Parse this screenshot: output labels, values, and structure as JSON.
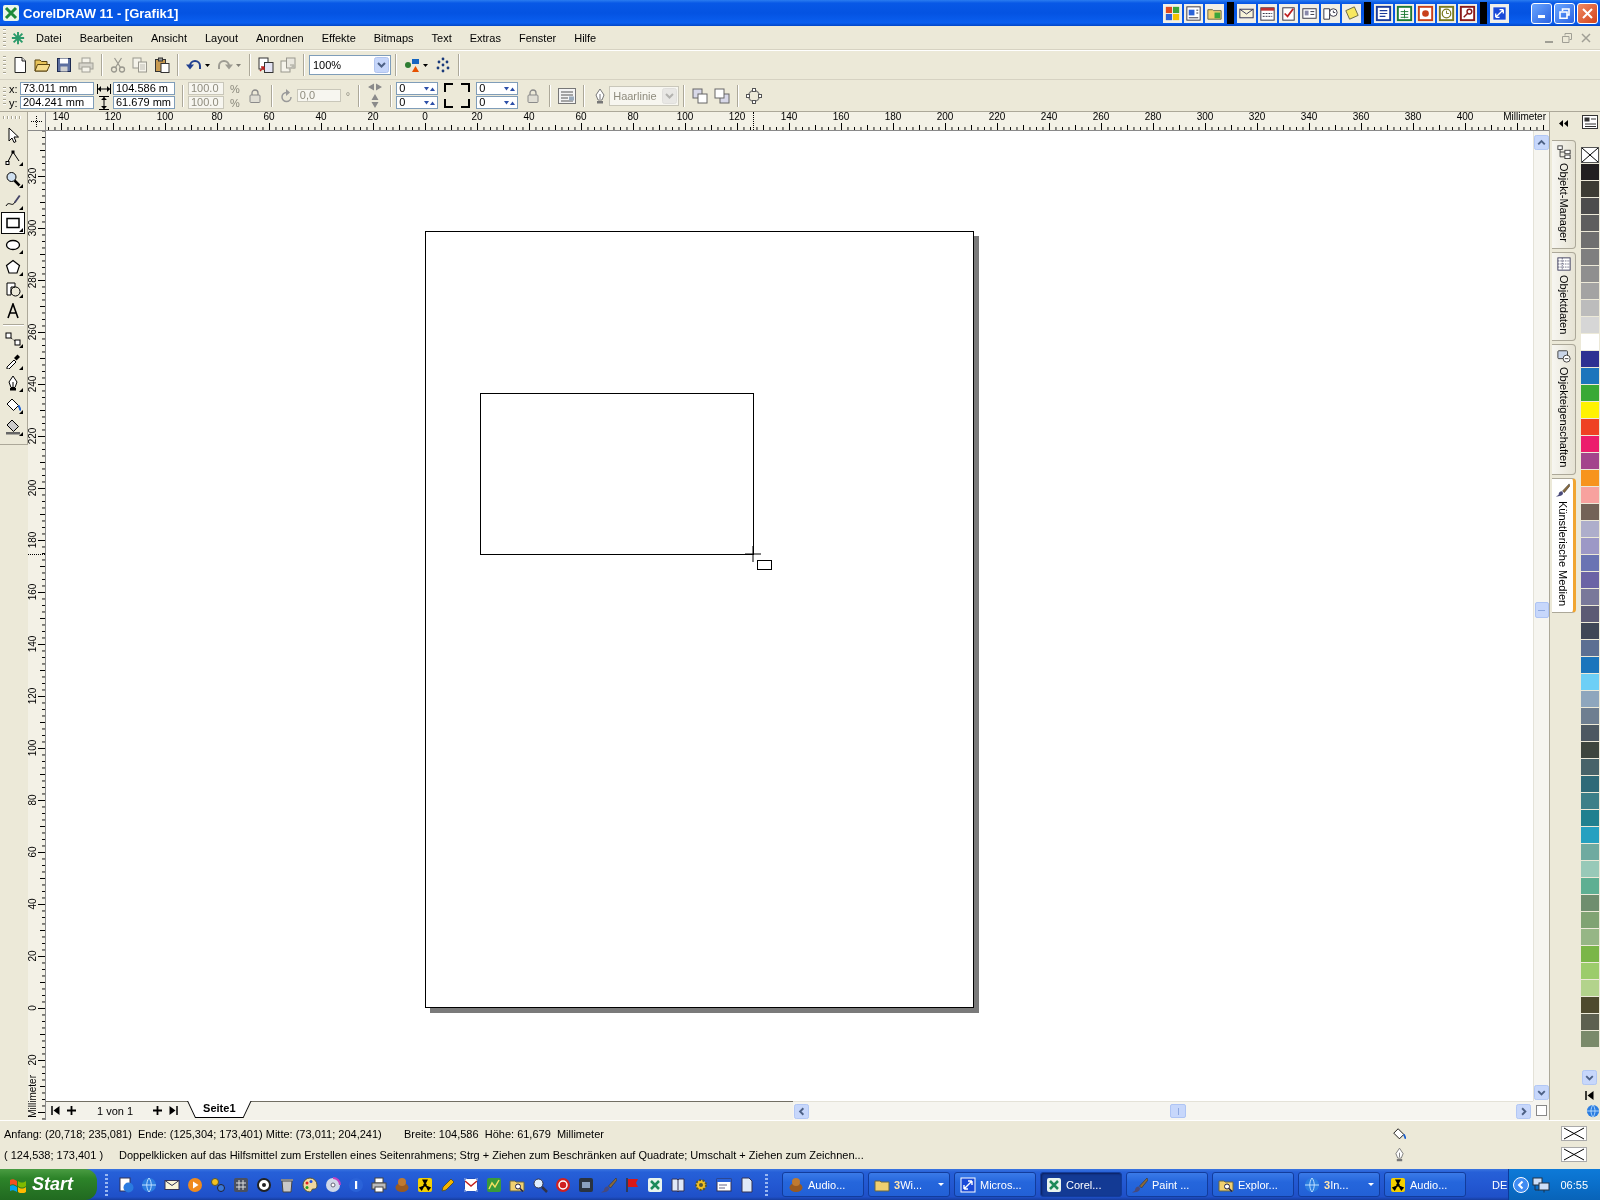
{
  "window": {
    "title": "CorelDRAW 11 - [Grafik1]"
  },
  "menu": [
    "Datei",
    "Bearbeiten",
    "Ansicht",
    "Layout",
    "Anordnen",
    "Effekte",
    "Bitmaps",
    "Text",
    "Extras",
    "Fenster",
    "Hilfe"
  ],
  "document_buttons": {
    "disabled": true
  },
  "standard_toolbar": {
    "left_buttons": [
      {
        "kind": "button",
        "disabled": false
      },
      {
        "kind": "button",
        "disabled": false
      },
      {
        "kind": "button",
        "disabled": false
      },
      {
        "kind": "button",
        "disabled": true
      },
      {
        "kind": "button",
        "disabled": true
      },
      {
        "kind": "button",
        "disabled": true
      },
      {
        "kind": "button",
        "disabled": false
      },
      {
        "kind": "split",
        "disabled": false
      },
      {
        "kind": "split",
        "disabled": true
      },
      {
        "kind": "button",
        "disabled": false
      },
      {
        "kind": "button",
        "disabled": true
      }
    ],
    "zoom": {
      "value": "100%"
    },
    "right_buttons": [
      {
        "kind": "split",
        "disabled": false
      },
      {
        "kind": "button",
        "disabled": false
      }
    ]
  },
  "property_bar": {
    "x": {
      "label": "x:",
      "value": "73.011 mm"
    },
    "y": {
      "label": "y:",
      "value": "204.241 mm"
    },
    "width": {
      "value": "104.586 m"
    },
    "height": {
      "value": "61.679 mm"
    },
    "scale": [
      {
        "value": "100.0",
        "unit": "%",
        "disabled": true
      },
      {
        "value": "100.0",
        "unit": "%",
        "disabled": true
      }
    ],
    "rotation": {
      "value": "0,0",
      "unit": "°",
      "disabled": true
    },
    "corner_roundness": [
      "0",
      "0",
      "0",
      "0"
    ],
    "outline_width": {
      "value": "Haarlinie",
      "disabled": true
    }
  },
  "rulers": {
    "horizontal": {
      "labels": [
        "140",
        "120",
        "100",
        "80",
        "60",
        "40",
        "20",
        "0",
        "20",
        "40",
        "60",
        "80",
        "100",
        "120",
        "140",
        "160",
        "180",
        "200",
        "220",
        "240",
        "260",
        "280",
        "300",
        "320",
        "340",
        "360",
        "380",
        "400"
      ],
      "unit": "Millimeter"
    },
    "vertical": {
      "labels": [
        "320",
        "300",
        "280",
        "260",
        "240",
        "220",
        "200",
        "180",
        "160",
        "140",
        "120",
        "100",
        "80",
        "60",
        "40",
        "20",
        "0",
        "20"
      ],
      "unit": "Millimeter"
    }
  },
  "toolbox": {
    "tools": [
      {
        "selected": false,
        "flyout": false
      },
      {
        "selected": false,
        "flyout": true
      },
      {
        "selected": false,
        "flyout": true
      },
      {
        "selected": false,
        "flyout": true
      },
      {
        "selected": true,
        "flyout": true
      },
      {
        "selected": false,
        "flyout": true
      },
      {
        "selected": false,
        "flyout": true
      },
      {
        "selected": false,
        "flyout": true
      },
      {
        "selected": false,
        "flyout": false
      },
      {
        "selected": false,
        "flyout": true
      },
      {
        "selected": false,
        "flyout": true
      },
      {
        "selected": false,
        "flyout": true
      },
      {
        "selected": false,
        "flyout": true
      },
      {
        "selected": false,
        "flyout": true
      }
    ]
  },
  "page_navigator": {
    "position": "1 von 1",
    "tabs": [
      {
        "label": "Seite1",
        "selected": true
      }
    ]
  },
  "docker_tabs": [
    {
      "label": "Objekt-Manager",
      "selected": false
    },
    {
      "label": "Objektdaten",
      "selected": false
    },
    {
      "label": "Objekteigenschaften",
      "selected": false
    },
    {
      "label": "Künstlerische Medien",
      "selected": true
    }
  ],
  "palette": {
    "swatches": [
      {
        "kind": "none"
      },
      {
        "kind": "color",
        "color": "#231f20"
      },
      {
        "kind": "color",
        "color": "#3c3b33"
      },
      {
        "kind": "color",
        "color": "#4d4d4d"
      },
      {
        "kind": "color",
        "color": "#5e5e5e"
      },
      {
        "kind": "color",
        "color": "#6f6f6f"
      },
      {
        "kind": "color",
        "color": "#7f7f7f"
      },
      {
        "kind": "color",
        "color": "#8f8f8f"
      },
      {
        "kind": "color",
        "color": "#a3a3a3"
      },
      {
        "kind": "color",
        "color": "#bcbcbc"
      },
      {
        "kind": "color",
        "color": "#d6d6d6"
      },
      {
        "kind": "color",
        "color": "#ffffff"
      },
      {
        "kind": "color",
        "color": "#2e3192"
      },
      {
        "kind": "color",
        "color": "#1c75bc"
      },
      {
        "kind": "color",
        "color": "#39a935"
      },
      {
        "kind": "color",
        "color": "#fff200"
      },
      {
        "kind": "color",
        "color": "#ef4123"
      },
      {
        "kind": "color",
        "color": "#ec1c6c"
      },
      {
        "kind": "color",
        "color": "#a3448c"
      },
      {
        "kind": "color",
        "color": "#f7941d"
      },
      {
        "kind": "color",
        "color": "#f7a29e"
      },
      {
        "kind": "color",
        "color": "#736357"
      },
      {
        "kind": "color",
        "color": "#aeaecb"
      },
      {
        "kind": "color",
        "color": "#9c98c6"
      },
      {
        "kind": "color",
        "color": "#6a74b3"
      },
      {
        "kind": "color",
        "color": "#6b63a5"
      },
      {
        "kind": "color",
        "color": "#79789a"
      },
      {
        "kind": "color",
        "color": "#5c5a74"
      },
      {
        "kind": "color",
        "color": "#3f4656"
      },
      {
        "kind": "color",
        "color": "#5c6f92"
      },
      {
        "kind": "color",
        "color": "#1b75bc"
      },
      {
        "kind": "color",
        "color": "#6dcff6"
      },
      {
        "kind": "color",
        "color": "#8ea6bd"
      },
      {
        "kind": "color",
        "color": "#6e7e90"
      },
      {
        "kind": "color",
        "color": "#4d5861"
      },
      {
        "kind": "color",
        "color": "#3e463e"
      },
      {
        "kind": "color",
        "color": "#476369"
      },
      {
        "kind": "color",
        "color": "#2e6a78"
      },
      {
        "kind": "color",
        "color": "#3c7f88"
      },
      {
        "kind": "color",
        "color": "#20808f"
      },
      {
        "kind": "color",
        "color": "#25a0c0"
      },
      {
        "kind": "color",
        "color": "#6faaa0"
      },
      {
        "kind": "color",
        "color": "#98c9b8"
      },
      {
        "kind": "color",
        "color": "#5eaf92"
      },
      {
        "kind": "color",
        "color": "#6f8e6e"
      },
      {
        "kind": "color",
        "color": "#80a373"
      },
      {
        "kind": "color",
        "color": "#96b686"
      },
      {
        "kind": "color",
        "color": "#7ab648"
      },
      {
        "kind": "color",
        "color": "#9ccc6b"
      },
      {
        "kind": "color",
        "color": "#b3d38c"
      },
      {
        "kind": "color",
        "color": "#4e4a2e"
      },
      {
        "kind": "color",
        "color": "#5d6050"
      },
      {
        "kind": "color",
        "color": "#7a8a6a"
      }
    ]
  },
  "status_bar": {
    "selection": "Anfang: (20,718; 235,081)  Ende: (125,304; 173,401) Mitte: (73,011; 204,241)",
    "size": "Breite: 104,586  Höhe: 61,679  Millimeter",
    "cursor": "( 124,538; 173,401 )",
    "hint": "Doppelklicken auf das Hilfsmittel zum Erstellen eines Seitenrahmens; Strg + Ziehen zum Beschränken auf Quadrate; Umschalt + Ziehen zum Zeichnen...",
    "fill": {
      "kind": "none"
    },
    "outline": {
      "kind": "none"
    }
  },
  "taskbar": {
    "start": "Start",
    "tasks": [
      {
        "label": "Audio...",
        "selected": false
      },
      {
        "count": "3",
        "label": "Wi...",
        "selected": false
      },
      {
        "label": "Micros...",
        "selected": false
      },
      {
        "label": "Corel...",
        "selected": true
      },
      {
        "label": "Paint ...",
        "selected": false
      },
      {
        "label": "Explor...",
        "selected": false
      },
      {
        "count": "3",
        "label": "In...",
        "selected": false
      },
      {
        "label": "Audio...",
        "selected": false
      }
    ],
    "language": "DE",
    "clock": "06:55"
  }
}
